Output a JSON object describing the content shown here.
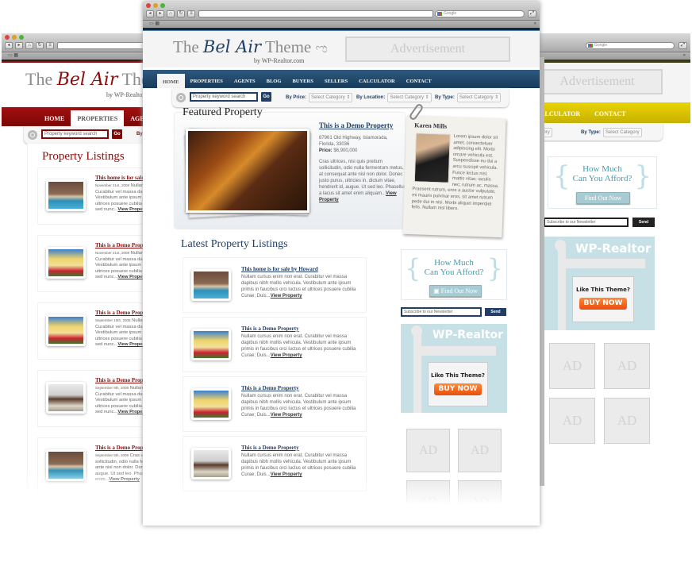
{
  "browser": {
    "search_engine": "Google",
    "bookmarks_overflow": "»",
    "nav_buttons": [
      "◂",
      "▸",
      "⌂",
      "↻",
      "≡"
    ],
    "resize_icon": "⤢"
  },
  "site": {
    "logo_the": "The",
    "logo_script": "Bel Air",
    "logo_theme": "Theme",
    "logo_byline": "by WP-Realtor.com",
    "advertisement": "Advertisement"
  },
  "nav": {
    "items": [
      "HOME",
      "PROPERTIES",
      "AGENTS",
      "BLOG",
      "BUYERS",
      "SELLERS",
      "CALCULATOR",
      "CONTACT"
    ]
  },
  "search": {
    "placeholder": "Property keyword search",
    "go_label": "Go",
    "by_price_label": "By Price:",
    "by_location_label": "By Location:",
    "by_type_label": "By Type:",
    "select_default": "Select Category"
  },
  "featured": {
    "section_title": "Featured Property",
    "title": "This is a Demo Property",
    "address_line1": "87961 Old Highway, Islamorada,",
    "address_line2": "Florida, 33036",
    "price_label": "Price:",
    "price": "$6,900,000",
    "description": "Cras ultrices, nisi quis pretium sollicitudin, odio nulla fermentum metus, at consequat ante nisl non dolor. Donec justo purus, ultricies in, dictum vitae, hendrerit id, augue. Ut sed leo. Phasellus a lacus sit amet enim aliquam...",
    "view_link": "View Property"
  },
  "agent": {
    "name": "Karen Mills",
    "bio": "Lorem ipsum dolor sit amet, consectetuer adipiscing elit. Morbi ornare vehicula est. Suspendisse eu dui a arcu suscipit vehicula. Fusce lectus nisl, mattis vitae; iaculis nec; rutrum ac, massa. Praesent rutrum, eros a auctor vulputate, mi mauris pulvinar eros, sit amet rutrum pede dui in nisi. Morbi aliquet imperdiet felis. Nullam nisl libero."
  },
  "latest": {
    "section_title": "Latest Property Listings",
    "items": [
      {
        "title": "This home is for sale by Howard",
        "text": "Nullam cursus enim non erat. Curabitur vel massa dapibus nibh mollis vehicula. Vestibulum ante ipsum primis in faucibus orci luctus et ultrices posuere cubilia Curae; Duis...",
        "link": "View Property",
        "thumb": "pool"
      },
      {
        "title": "This is a Demo Property",
        "text": "Nullam cursus enim non erat. Curabitur vel massa dapibus nibh mollis vehicula. Vestibulum ante ipsum primis in faucibus orci luctus et ultrices posuere cubilia Curae; Duis...",
        "link": "View Property",
        "thumb": "house"
      },
      {
        "title": "This is a Demo Property",
        "text": "Nullam cursus enim non erat. Curabitur vel massa dapibus nibh mollis vehicula. Vestibulum ante ipsum primis in faucibus orci luctus et ultrices posuere cubilia Curae; Duis...",
        "link": "View Property",
        "thumb": "house"
      },
      {
        "title": "This is a Demo Property",
        "text": "Nullam cursus enim non erat. Curabitur vel massa dapibus nibh mollis vehicula. Vestibulum ante ipsum primis in faucibus orci luctus et ultrices posuere cubilia Curae; Duis...",
        "link": "View Property",
        "thumb": "interior"
      }
    ]
  },
  "sidebar": {
    "afford_line1": "How Much",
    "afford_line2": "Can You Afford?",
    "find_out": "Find Out Now",
    "newsletter_placeholder": "Subscribe to our Newsletter",
    "send_label": "Send",
    "wpr_brand_a": "WP-",
    "wpr_brand_b": "Realtor",
    "like_theme": "Like This Theme?",
    "buy_now": "BUY NOW",
    "ad_label": "AD"
  },
  "left_window": {
    "section_title": "Property Listings",
    "items": [
      {
        "title": "This home is for sale by Howard",
        "date": "November 21st, 2008",
        "text": "Nullam cursus enim non erat. Curabitur vel massa dapibus nibh mollis vehicula. Vestibulum ante ipsum primis in faucibus orci luctus et ultrices posuere cubilia Curae; Duis quis ante. Donec sed nunc...",
        "link": "View Property",
        "thumb": "pool"
      },
      {
        "title": "This is a Demo Property",
        "date": "November 21st, 2008",
        "text": "Nullam cursus enim non erat. Curabitur vel massa dapibus nibh mollis vehicula. Vestibulum ante ipsum primis in faucibus orci luctus et ultrices posuere cubilia Curae; Duis quis ante. Donec sed nunc...",
        "link": "View Property",
        "thumb": "house"
      },
      {
        "title": "This is a Demo Property",
        "date": "September 10th, 2008",
        "text": "Nullam cursus enim non erat. Curabitur vel massa dapibus nibh mollis vehicula. Vestibulum ante ipsum primis in faucibus orci luctus et ultrices posuere cubilia Curae; Duis quis ante. Donec sed nunc...",
        "link": "View Property",
        "thumb": "house"
      },
      {
        "title": "This is a Demo Property",
        "date": "September 9th, 2008",
        "text": "Nullam cursus enim non erat. Curabitur vel massa dapibus nibh mollis vehicula. Vestibulum ante ipsum primis in faucibus orci luctus et ultrices posuere cubilia Curae; Duis quis ante. Donec sed nunc...",
        "link": "View Property",
        "thumb": "interior"
      },
      {
        "title": "This is a Demo Property",
        "date": "September 5th, 2008",
        "text": "Cras ultrices, nisi quis pretium sollicitudin, odio nulla fermentum metus, at consequat ante nisl non dolor. Donec justo purus, hendrerit id, augue. Ut sed leo. Phasellus a lacus sit amet enim...",
        "link": "View Property",
        "thumb": "pool"
      }
    ]
  },
  "colors": {
    "blue_theme_nav": "#1f4a6e",
    "red_theme_nav": "#8e0b0b",
    "yellow_theme_nav": "#d6c200",
    "link_blue": "#1f3f67",
    "link_red": "#8e0b0b",
    "accent_teal": "#3e9eb4",
    "buy_orange": "#ef5d12"
  }
}
